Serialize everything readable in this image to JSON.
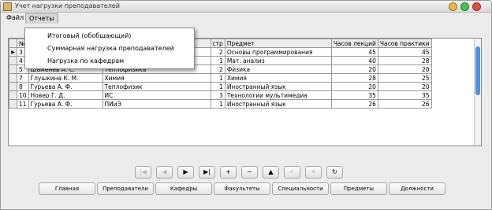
{
  "window": {
    "title": "Учет нагрузки преподавателей",
    "title_icon": "app-icon",
    "controls": [
      {
        "name": "minimize",
        "color": "#f2b33d"
      },
      {
        "name": "maximize",
        "color": "#46c34a"
      },
      {
        "name": "close",
        "color": "#e84b3c"
      }
    ]
  },
  "menu": {
    "items": [
      {
        "label": "Файл"
      },
      {
        "label": "Отчеты"
      }
    ],
    "dropdown": [
      {
        "label": "Итоговый (обобщающий)"
      },
      {
        "label": "Суммарная нагрузка преподавателей"
      },
      {
        "label": "Нагрузка по кафедрам"
      }
    ]
  },
  "table": {
    "columns": [
      "№",
      "",
      "",
      "стр",
      "Предмет",
      "Часов лекций",
      "Часов практики"
    ],
    "current_row_marker": "▶",
    "rows": [
      [
        "3",
        "",
        "",
        "2",
        "Основы программирования",
        "45",
        "45"
      ],
      [
        "4",
        "",
        "",
        "1",
        "Мат. анализ",
        "40",
        "28"
      ],
      [
        "5",
        "Шаменев А. С.",
        "Теплофизика",
        "2",
        "Физика",
        "20",
        "20"
      ],
      [
        "7",
        "Глушкина К. М.",
        "Химия",
        "1",
        "Химия",
        "28",
        "25"
      ],
      [
        "8",
        "Гурьева А. Ф.",
        "Теплофизик",
        "1",
        "Иностранный язык",
        "20",
        "20"
      ],
      [
        "10",
        "Новер Г. Д.",
        "ИС",
        "3",
        "Технологии мультимедиа",
        "35",
        "35"
      ],
      [
        "11",
        "Гурьева А. Ф.",
        "ПИиЭ",
        "1",
        "Иностранный язык",
        "26",
        "26"
      ]
    ]
  },
  "navigator": [
    {
      "label": "|◀",
      "enabled": false
    },
    {
      "label": "◀",
      "enabled": false
    },
    {
      "label": "▶",
      "enabled": true
    },
    {
      "label": "▶|",
      "enabled": true
    },
    {
      "label": "+",
      "enabled": true
    },
    {
      "label": "−",
      "enabled": true
    },
    {
      "label": "▲",
      "enabled": true
    },
    {
      "label": "✓",
      "enabled": false
    },
    {
      "label": "✕",
      "enabled": false
    },
    {
      "label": "↻",
      "enabled": true
    }
  ],
  "bottom_tabs": [
    {
      "label": "Главная"
    },
    {
      "label": "Преподаватели"
    },
    {
      "label": "Кафедры"
    },
    {
      "label": "Факультеты"
    },
    {
      "label": "Специальности"
    },
    {
      "label": "Предметы"
    },
    {
      "label": "Должности"
    }
  ]
}
